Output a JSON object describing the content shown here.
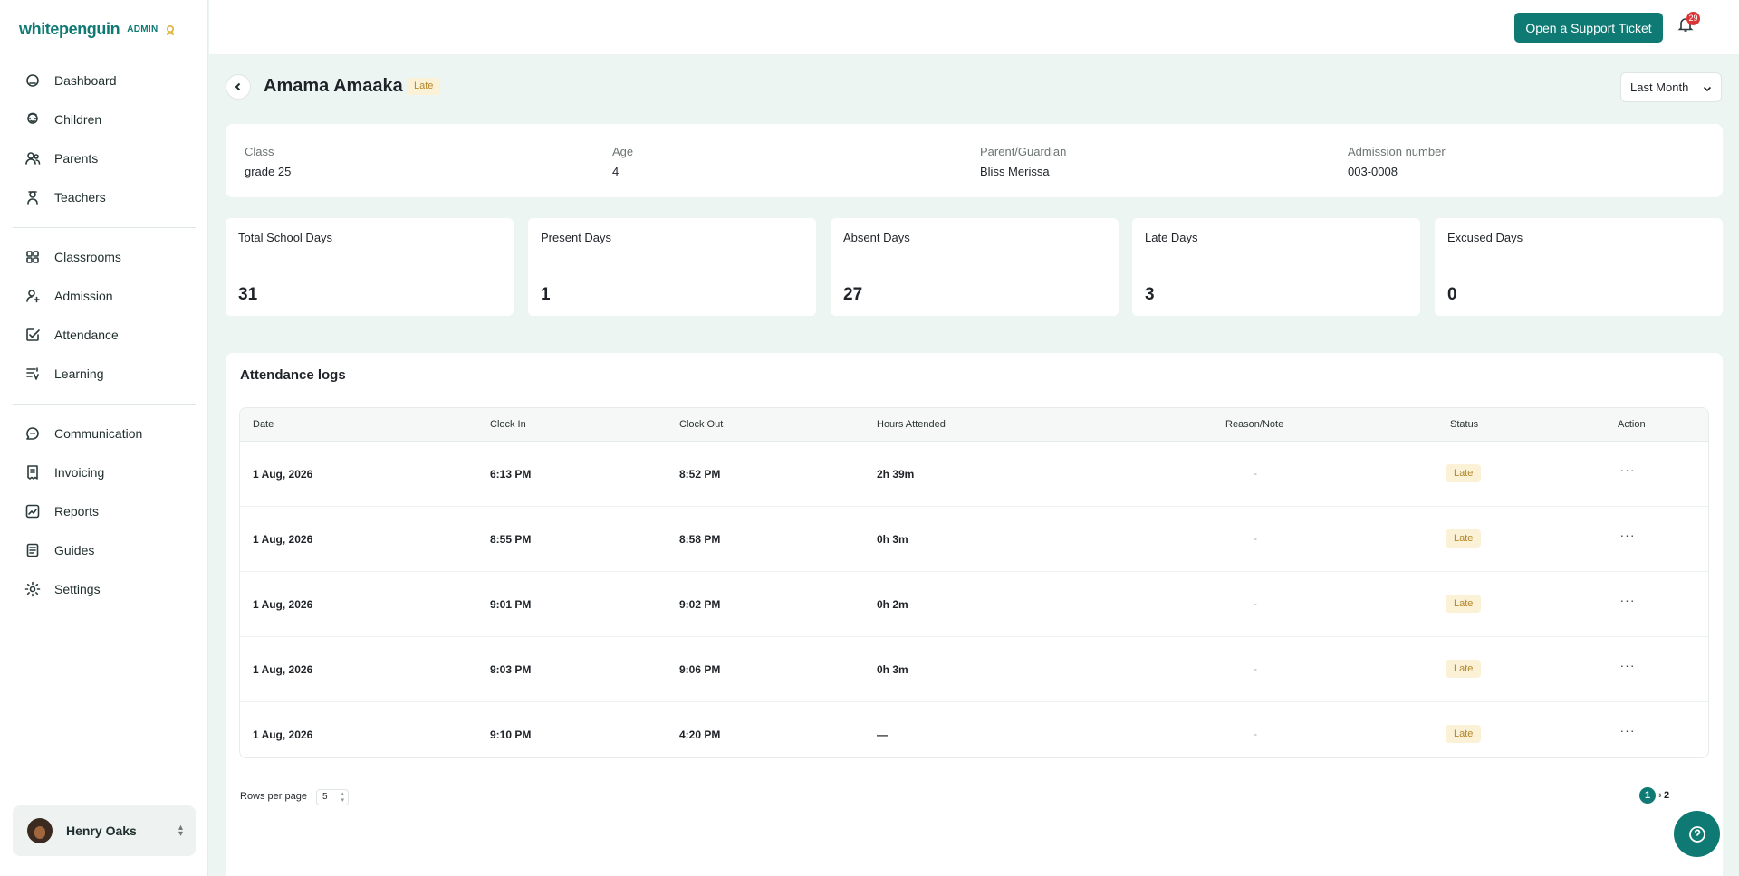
{
  "brand": {
    "name": "whitepenguin",
    "role": "ADMIN"
  },
  "sidebar": {
    "groups": [
      [
        {
          "label": "Dashboard",
          "icon": "dashboard-icon"
        },
        {
          "label": "Children",
          "icon": "children-icon"
        },
        {
          "label": "Parents",
          "icon": "parents-icon"
        },
        {
          "label": "Teachers",
          "icon": "teachers-icon"
        }
      ],
      [
        {
          "label": "Classrooms",
          "icon": "classrooms-icon"
        },
        {
          "label": "Admission",
          "icon": "admission-icon"
        },
        {
          "label": "Attendance",
          "icon": "attendance-icon"
        },
        {
          "label": "Learning",
          "icon": "learning-icon"
        }
      ],
      [
        {
          "label": "Communication",
          "icon": "communication-icon"
        },
        {
          "label": "Invoicing",
          "icon": "invoicing-icon"
        },
        {
          "label": "Reports",
          "icon": "reports-icon"
        },
        {
          "label": "Guides",
          "icon": "guides-icon"
        },
        {
          "label": "Settings",
          "icon": "settings-icon"
        }
      ]
    ],
    "user": {
      "name": "Henry Oaks"
    }
  },
  "topbar": {
    "support_label": "Open a Support Ticket",
    "notification_count": "29"
  },
  "header": {
    "name": "Amama Amaaka",
    "status": "Late",
    "period": "Last Month"
  },
  "info": [
    {
      "label": "Class",
      "value": "grade 25"
    },
    {
      "label": "Age",
      "value": "4"
    },
    {
      "label": "Parent/Guardian",
      "value": "Bliss Merissa"
    },
    {
      "label": "Admission number",
      "value": "003-0008"
    }
  ],
  "stats": [
    {
      "label": "Total School Days",
      "value": "31"
    },
    {
      "label": "Present Days",
      "value": "1"
    },
    {
      "label": "Absent Days",
      "value": "27"
    },
    {
      "label": "Late Days",
      "value": "3"
    },
    {
      "label": "Excused Days",
      "value": "0"
    }
  ],
  "logs": {
    "title": "Attendance logs",
    "columns": [
      "Date",
      "Clock In",
      "Clock Out",
      "Hours Attended",
      "Reason/Note",
      "Status",
      "Action"
    ],
    "rows": [
      {
        "date": "1 Aug, 2026",
        "clock_in": "6:13 PM",
        "clock_out": "8:52 PM",
        "hours": "2h 39m",
        "note": "-",
        "status": "Late"
      },
      {
        "date": "1 Aug, 2026",
        "clock_in": "8:55 PM",
        "clock_out": "8:58 PM",
        "hours": "0h 3m",
        "note": "-",
        "status": "Late"
      },
      {
        "date": "1 Aug, 2026",
        "clock_in": "9:01 PM",
        "clock_out": "9:02 PM",
        "hours": "0h 2m",
        "note": "-",
        "status": "Late"
      },
      {
        "date": "1 Aug, 2026",
        "clock_in": "9:03 PM",
        "clock_out": "9:06 PM",
        "hours": "0h 3m",
        "note": "-",
        "status": "Late"
      },
      {
        "date": "1 Aug, 2026",
        "clock_in": "9:10 PM",
        "clock_out": "4:20 PM",
        "hours": "—",
        "note": "-",
        "status": "Late"
      }
    ],
    "rows_per_page_label": "Rows per page",
    "rows_per_page": "5",
    "pages": [
      "1",
      "2"
    ],
    "current_page": "1"
  },
  "colors": {
    "accent": "#0e7a73",
    "late_bg": "#fbf1d6",
    "late_fg": "#b3882a",
    "badge": "#d93636"
  }
}
